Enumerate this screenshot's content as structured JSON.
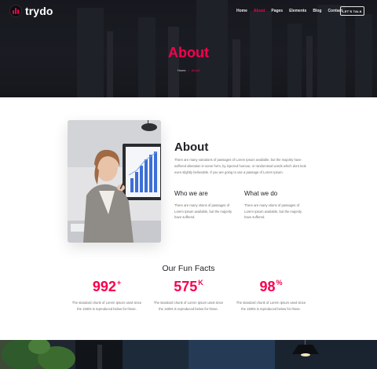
{
  "brand": {
    "name": "trydo",
    "accent": "#f9004d"
  },
  "nav": {
    "items": [
      {
        "label": "Home",
        "active": false
      },
      {
        "label": "About",
        "active": true
      },
      {
        "label": "Pages",
        "active": false
      },
      {
        "label": "Elements",
        "active": false
      },
      {
        "label": "Blog",
        "active": false
      },
      {
        "label": "Contact",
        "active": false
      }
    ],
    "cta_label": "LET'S TALK"
  },
  "hero": {
    "title": "About",
    "breadcrumb": {
      "home": "Home",
      "separator": "/",
      "current": "About"
    }
  },
  "about": {
    "heading": "About",
    "description": "There are many variations of passages of Lorem Ipsum available, but the majority have suffered alteration in some form, by injected humour, or randomised words which dont look even slightly believable. If you are going to use a passage of Lorem Ipsum.",
    "columns": [
      {
        "title": "Who we are",
        "text": "There are many vtions of passages of Lorem Ipsum available, but the majority have suffered."
      },
      {
        "title": "What we do",
        "text": "There are many vtions of passages of Lorem Ipsum available, but the majority have suffered."
      }
    ]
  },
  "facts": {
    "title": "Our Fun Facts",
    "items": [
      {
        "value": "992",
        "suffix": "+",
        "description": "The standard chunk of Lorem Ipsum used since the 1500s is reproduced below for those."
      },
      {
        "value": "575",
        "suffix": "K",
        "description": "The standard chunk of Lorem Ipsum used since the 1500s is reproduced below for those."
      },
      {
        "value": "98",
        "suffix": "%",
        "description": "The standard chunk of Lorem Ipsum used since the 1500s is reproduced below for those."
      }
    ]
  }
}
